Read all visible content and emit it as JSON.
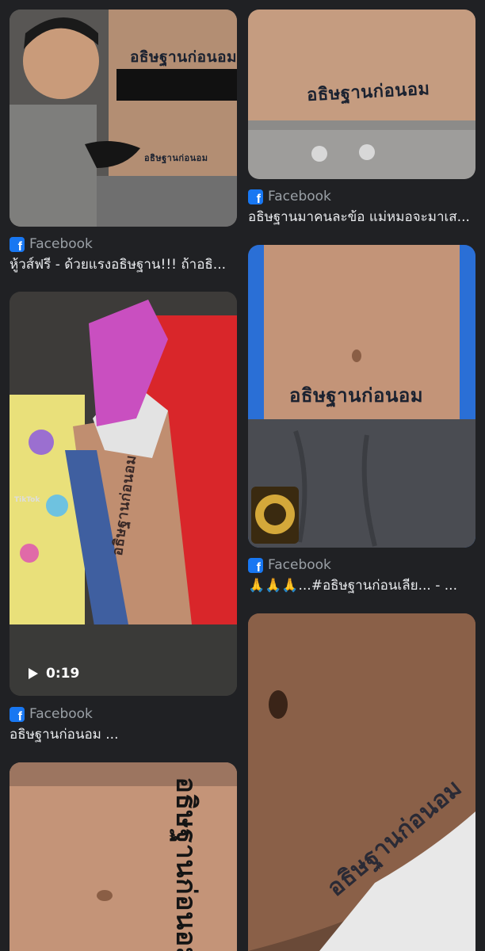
{
  "results": [
    {
      "source": "Facebook",
      "caption": "หู้วส์ฟรี - ด้วยแรงอธิษฐาน!!! ถ้าอธิ...",
      "tattoo_text": "อธิษฐานก่อนอม"
    },
    {
      "source": "Facebook",
      "caption": "อธิษฐานมาคนละข้อ แม่หมอจะมาเส...",
      "tattoo_text": "อธิษฐานก่อนอม"
    },
    {
      "source": "Facebook",
      "caption": "🙏🙏🙏...#อธิษฐานก่อนเลีย... - ...",
      "tattoo_text": "อธิษฐานก่อนอม"
    },
    {
      "source": "Facebook",
      "caption": "อธิษฐานก่อนอม ...",
      "tattoo_text": "อธิษฐานก่อนอม",
      "video_duration": "0:19",
      "watermark": "TikTok"
    },
    {
      "tattoo_text": "อธิษฐานก่อนอม"
    },
    {
      "tattoo_text": "อธิษฐานก่อนอม"
    }
  ],
  "colors": {
    "background": "#202124",
    "facebook_blue": "#1877f2",
    "source_text": "#9aa0a6",
    "caption_text": "#e8eaed"
  },
  "icons": [
    "facebook-icon",
    "play-icon"
  ]
}
